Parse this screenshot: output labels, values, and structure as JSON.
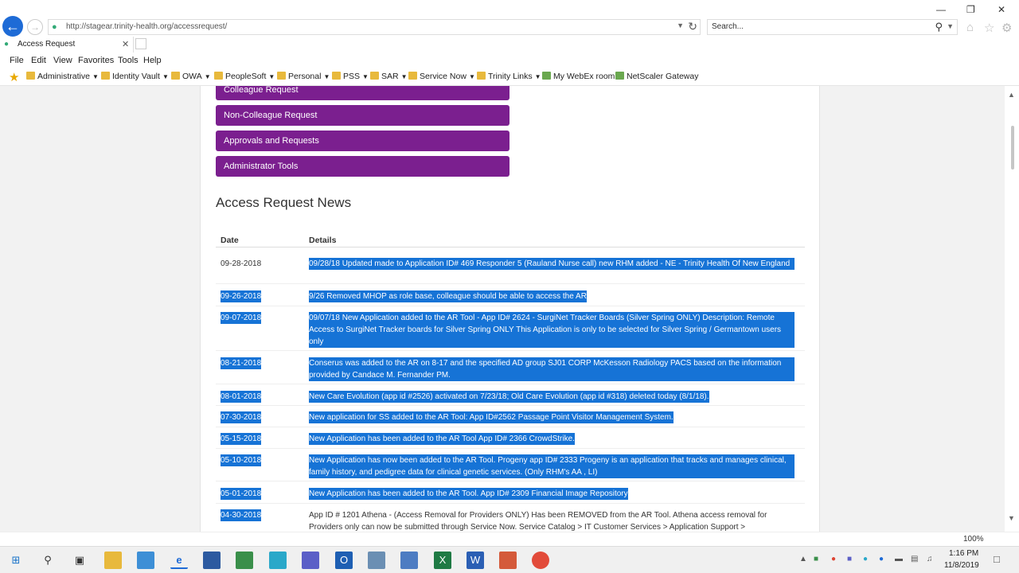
{
  "browser": {
    "url": "http://stagear.trinity-health.org/accessrequest/",
    "search_placeholder": "Search...",
    "tab_title": "Access Request",
    "menu": [
      "File",
      "Edit",
      "View",
      "Favorites",
      "Tools",
      "Help"
    ],
    "favorites": [
      {
        "label": "Administrative",
        "dropdown": true
      },
      {
        "label": "Identity Vault",
        "dropdown": true
      },
      {
        "label": "OWA",
        "dropdown": true
      },
      {
        "label": "PeopleSoft",
        "dropdown": true
      },
      {
        "label": "Personal",
        "dropdown": true
      },
      {
        "label": "PSS",
        "dropdown": true
      },
      {
        "label": "SAR",
        "dropdown": true
      },
      {
        "label": "Service Now",
        "dropdown": true
      },
      {
        "label": "Trinity Links",
        "dropdown": true
      },
      {
        "label": "My WebEx room",
        "dropdown": false
      },
      {
        "label": "NetScaler Gateway",
        "dropdown": false
      }
    ],
    "zoom": "100%"
  },
  "page": {
    "nav_buttons": [
      "Colleague Request",
      "Non-Colleague Request",
      "Approvals and Requests",
      "Administrator Tools"
    ],
    "news_title": "Access Request News",
    "table_headers": {
      "date": "Date",
      "details": "Details"
    },
    "news": [
      {
        "date": "09-28-2018",
        "details": "09/28/18 Updated made to Application ID# 469 Responder 5 (Rauland Nurse call) new RHM added - NE - Trinity Health Of New England"
      },
      {
        "date": "09-26-2018",
        "details": "9/26 Removed MHOP as role base, colleague should be able to access the AR"
      },
      {
        "date": "09-07-2018",
        "details": "09/07/18 New Application added to the AR Tool - App ID# 2624 - SurgiNet Tracker Boards (Silver Spring ONLY) Description: Remote Access to SurgiNet Tracker boards for Silver Spring ONLY This Application is only to be selected for Silver Spring / Germantown users only"
      },
      {
        "date": "08-21-2018",
        "details": "Conserus was added to the AR on 8-17 and the specified AD group SJ01 CORP McKesson Radiology PACS based on the information provided by Candace M. Fernander PM."
      },
      {
        "date": "08-01-2018",
        "details": "New Care Evolution (app id #2526) activated on 7/23/18; Old Care Evolution (app id #318) deleted today (8/1/18)."
      },
      {
        "date": "07-30-2018",
        "details": "New application for SS added to the AR Tool: App ID#2562 Passage Point Visitor Management System."
      },
      {
        "date": "05-15-2018",
        "details": "New Application has been added to the AR Tool App ID# 2366 CrowdStrike."
      },
      {
        "date": "05-10-2018",
        "details": "New Application has now been added to the AR Tool. Progeny app ID# 2333 Progeny is an application that tracks and manages clinical, family history, and pedigree data for clinical genetic services. (Only RHM's AA , LI)"
      },
      {
        "date": "05-01-2018",
        "details": "New Application has been added to the AR Tool. App ID# 2309 Financial Image Repository"
      },
      {
        "date": "04-30-2018",
        "details": "App ID # 1201 Athena - (Access Removal for Providers ONLY) Has been REMOVED from the AR Tool. Athena access removal for Providers only can now be submitted through Service Now. Service Catalog > IT Customer Services > Application Support >"
      }
    ]
  },
  "taskbar": {
    "time": "1:16 PM",
    "date": "11/8/2019"
  }
}
